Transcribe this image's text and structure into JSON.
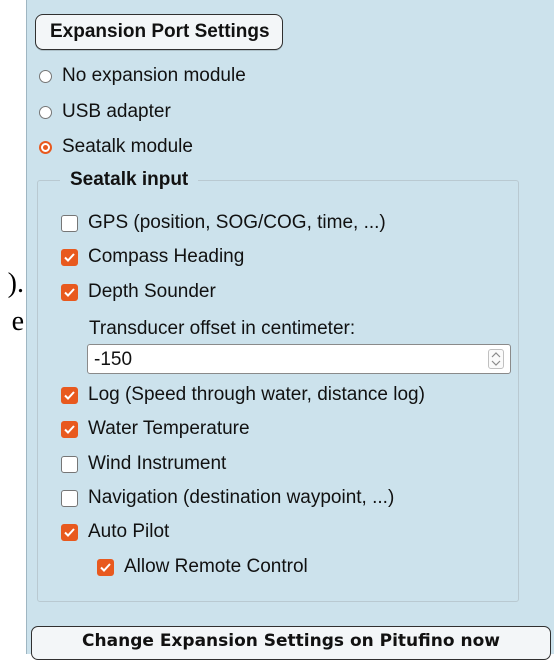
{
  "left_fragments": [
    ").",
    "e"
  ],
  "panel": {
    "title": "Expansion Port Settings",
    "radios": [
      {
        "label": "No expansion module",
        "checked": false
      },
      {
        "label": "USB adapter",
        "checked": false
      },
      {
        "label": "Seatalk module",
        "checked": true
      }
    ],
    "seatalk": {
      "legend": "Seatalk input",
      "items": [
        {
          "label": "GPS (position, SOG/COG, time, ...)",
          "checked": false
        },
        {
          "label": "Compass Heading",
          "checked": true
        },
        {
          "label": "Depth Sounder",
          "checked": true
        },
        {
          "label": "Log (Speed through water, distance log)",
          "checked": true
        },
        {
          "label": "Water Temperature",
          "checked": true
        },
        {
          "label": "Wind Instrument",
          "checked": false
        },
        {
          "label": "Navigation (destination waypoint, ...)",
          "checked": false
        },
        {
          "label": "Auto Pilot",
          "checked": true
        },
        {
          "label": "Allow Remote Control",
          "checked": true
        }
      ],
      "transducer_label": "Transducer offset in centimeter:",
      "transducer_value": "-150"
    },
    "apply_button": "Change Expansion Settings on Pitufino now"
  },
  "colors": {
    "panel_bg": "#cce2ec",
    "accent": "#e8591e"
  }
}
